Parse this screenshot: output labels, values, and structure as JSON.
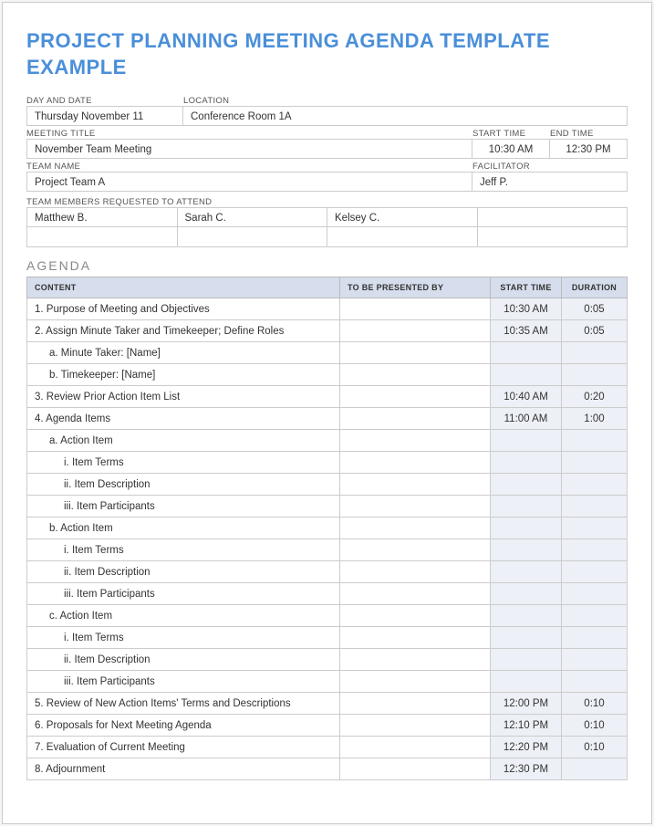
{
  "title": "PROJECT PLANNING MEETING AGENDA TEMPLATE EXAMPLE",
  "labels": {
    "dayDate": "DAY AND DATE",
    "location": "LOCATION",
    "meetingTitle": "MEETING TITLE",
    "startTime": "START TIME",
    "endTime": "END TIME",
    "teamName": "TEAM NAME",
    "facilitator": "FACILITATOR",
    "membersRequested": "TEAM MEMBERS REQUESTED TO ATTEND"
  },
  "info": {
    "dayDate": "Thursday November 11",
    "location": "Conference Room 1A",
    "meetingTitle": "November Team Meeting",
    "startTime": "10:30 AM",
    "endTime": "12:30 PM",
    "teamName": "Project Team A",
    "facilitator": "Jeff P.",
    "members": [
      "Matthew B.",
      "Sarah C.",
      "Kelsey C.",
      ""
    ]
  },
  "agendaTitle": "AGENDA",
  "agendaHeaders": {
    "content": "CONTENT",
    "presenter": "TO BE PRESENTED BY",
    "start": "START TIME",
    "duration": "DURATION"
  },
  "agenda": [
    {
      "content": "1. Purpose of Meeting and Objectives",
      "indent": 0,
      "presenter": "",
      "start": "10:30 AM",
      "duration": "0:05"
    },
    {
      "content": "2. Assign Minute Taker and Timekeeper; Define Roles",
      "indent": 0,
      "presenter": "",
      "start": "10:35 AM",
      "duration": "0:05"
    },
    {
      "content": "a. Minute Taker: [Name]",
      "indent": 1,
      "presenter": "",
      "start": "",
      "duration": ""
    },
    {
      "content": "b. Timekeeper: [Name]",
      "indent": 1,
      "presenter": "",
      "start": "",
      "duration": ""
    },
    {
      "content": "3. Review Prior Action Item List",
      "indent": 0,
      "presenter": "",
      "start": "10:40 AM",
      "duration": "0:20"
    },
    {
      "content": "4. Agenda Items",
      "indent": 0,
      "presenter": "",
      "start": "11:00 AM",
      "duration": "1:00"
    },
    {
      "content": "a. Action Item",
      "indent": 1,
      "presenter": "",
      "start": "",
      "duration": ""
    },
    {
      "content": "i. Item Terms",
      "indent": 2,
      "presenter": "",
      "start": "",
      "duration": ""
    },
    {
      "content": "ii. Item Description",
      "indent": 2,
      "presenter": "",
      "start": "",
      "duration": ""
    },
    {
      "content": "iii. Item Participants",
      "indent": 2,
      "presenter": "",
      "start": "",
      "duration": ""
    },
    {
      "content": "b. Action Item",
      "indent": 1,
      "presenter": "",
      "start": "",
      "duration": ""
    },
    {
      "content": "i. Item Terms",
      "indent": 2,
      "presenter": "",
      "start": "",
      "duration": ""
    },
    {
      "content": "ii. Item Description",
      "indent": 2,
      "presenter": "",
      "start": "",
      "duration": ""
    },
    {
      "content": "iii. Item Participants",
      "indent": 2,
      "presenter": "",
      "start": "",
      "duration": ""
    },
    {
      "content": "c. Action Item",
      "indent": 1,
      "presenter": "",
      "start": "",
      "duration": ""
    },
    {
      "content": "i. Item Terms",
      "indent": 2,
      "presenter": "",
      "start": "",
      "duration": ""
    },
    {
      "content": "ii. Item Description",
      "indent": 2,
      "presenter": "",
      "start": "",
      "duration": ""
    },
    {
      "content": "iii. Item Participants",
      "indent": 2,
      "presenter": "",
      "start": "",
      "duration": ""
    },
    {
      "content": "5. Review of New Action Items' Terms and Descriptions",
      "indent": 0,
      "presenter": "",
      "start": "12:00 PM",
      "duration": "0:10"
    },
    {
      "content": "6. Proposals for Next Meeting Agenda",
      "indent": 0,
      "presenter": "",
      "start": "12:10 PM",
      "duration": "0:10"
    },
    {
      "content": "7. Evaluation of Current Meeting",
      "indent": 0,
      "presenter": "",
      "start": "12:20 PM",
      "duration": "0:10"
    },
    {
      "content": "8. Adjournment",
      "indent": 0,
      "presenter": "",
      "start": "12:30 PM",
      "duration": ""
    }
  ]
}
